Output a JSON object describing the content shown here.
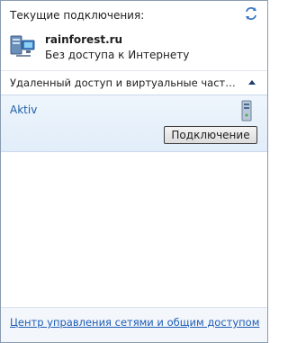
{
  "header": {
    "title": "Текущие подключения:",
    "refresh_icon": "refresh-icon"
  },
  "current_network": {
    "name": "rainforest.ru",
    "status": "Без доступа к Интернету",
    "icon": "network-computer-icon"
  },
  "section": {
    "label": "Удаленный доступ и виртуальные частные се...",
    "chevron": "chevron-up-icon"
  },
  "vpn": {
    "name": "Aktiv",
    "icon": "vpn-server-icon",
    "connect_label": "Подключение"
  },
  "footer": {
    "link": "Центр управления сетями и общим доступом"
  },
  "colors": {
    "accent": "#1f5fa8",
    "selected_bg": "#e6f0fb",
    "link": "#1d5cb6"
  }
}
